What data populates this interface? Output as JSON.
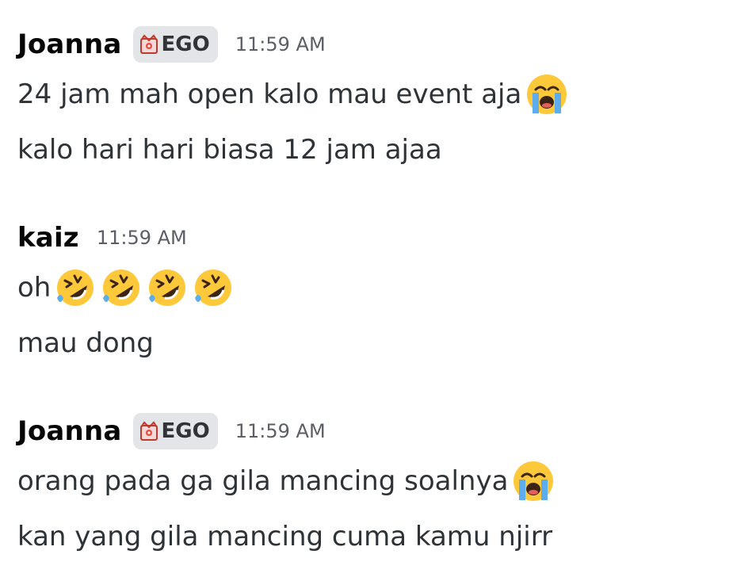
{
  "messages": [
    {
      "username": "Joanna",
      "tag": {
        "text": "EGO",
        "icon": "crown-tag-icon"
      },
      "timestamp": "11:59 AM",
      "lines": [
        {
          "text": "24 jam mah open kalo mau event aja",
          "emoji": [
            "loudly-crying-face-icon"
          ]
        },
        {
          "text": "kalo hari hari biasa 12 jam ajaa",
          "emoji": []
        }
      ]
    },
    {
      "username": "kaiz",
      "timestamp": "11:59 AM",
      "lines": [
        {
          "text": "oh",
          "emoji": [
            "rolling-on-floor-laughing-icon",
            "rolling-on-floor-laughing-icon",
            "rolling-on-floor-laughing-icon",
            "rolling-on-floor-laughing-icon"
          ]
        },
        {
          "text": "mau dong",
          "emoji": []
        }
      ]
    },
    {
      "username": "Joanna",
      "tag": {
        "text": "EGO",
        "icon": "crown-tag-icon"
      },
      "timestamp": "11:59 AM",
      "lines": [
        {
          "text": "orang pada ga gila mancing soalnya",
          "emoji": [
            "loudly-crying-face-icon"
          ]
        },
        {
          "text": "kan yang gila mancing cuma kamu njirr",
          "emoji": []
        }
      ]
    }
  ],
  "colors": {
    "username": "#060607",
    "text": "#2e3338",
    "timestamp": "#5c5e66",
    "tag_bg": "#e3e5e8"
  }
}
